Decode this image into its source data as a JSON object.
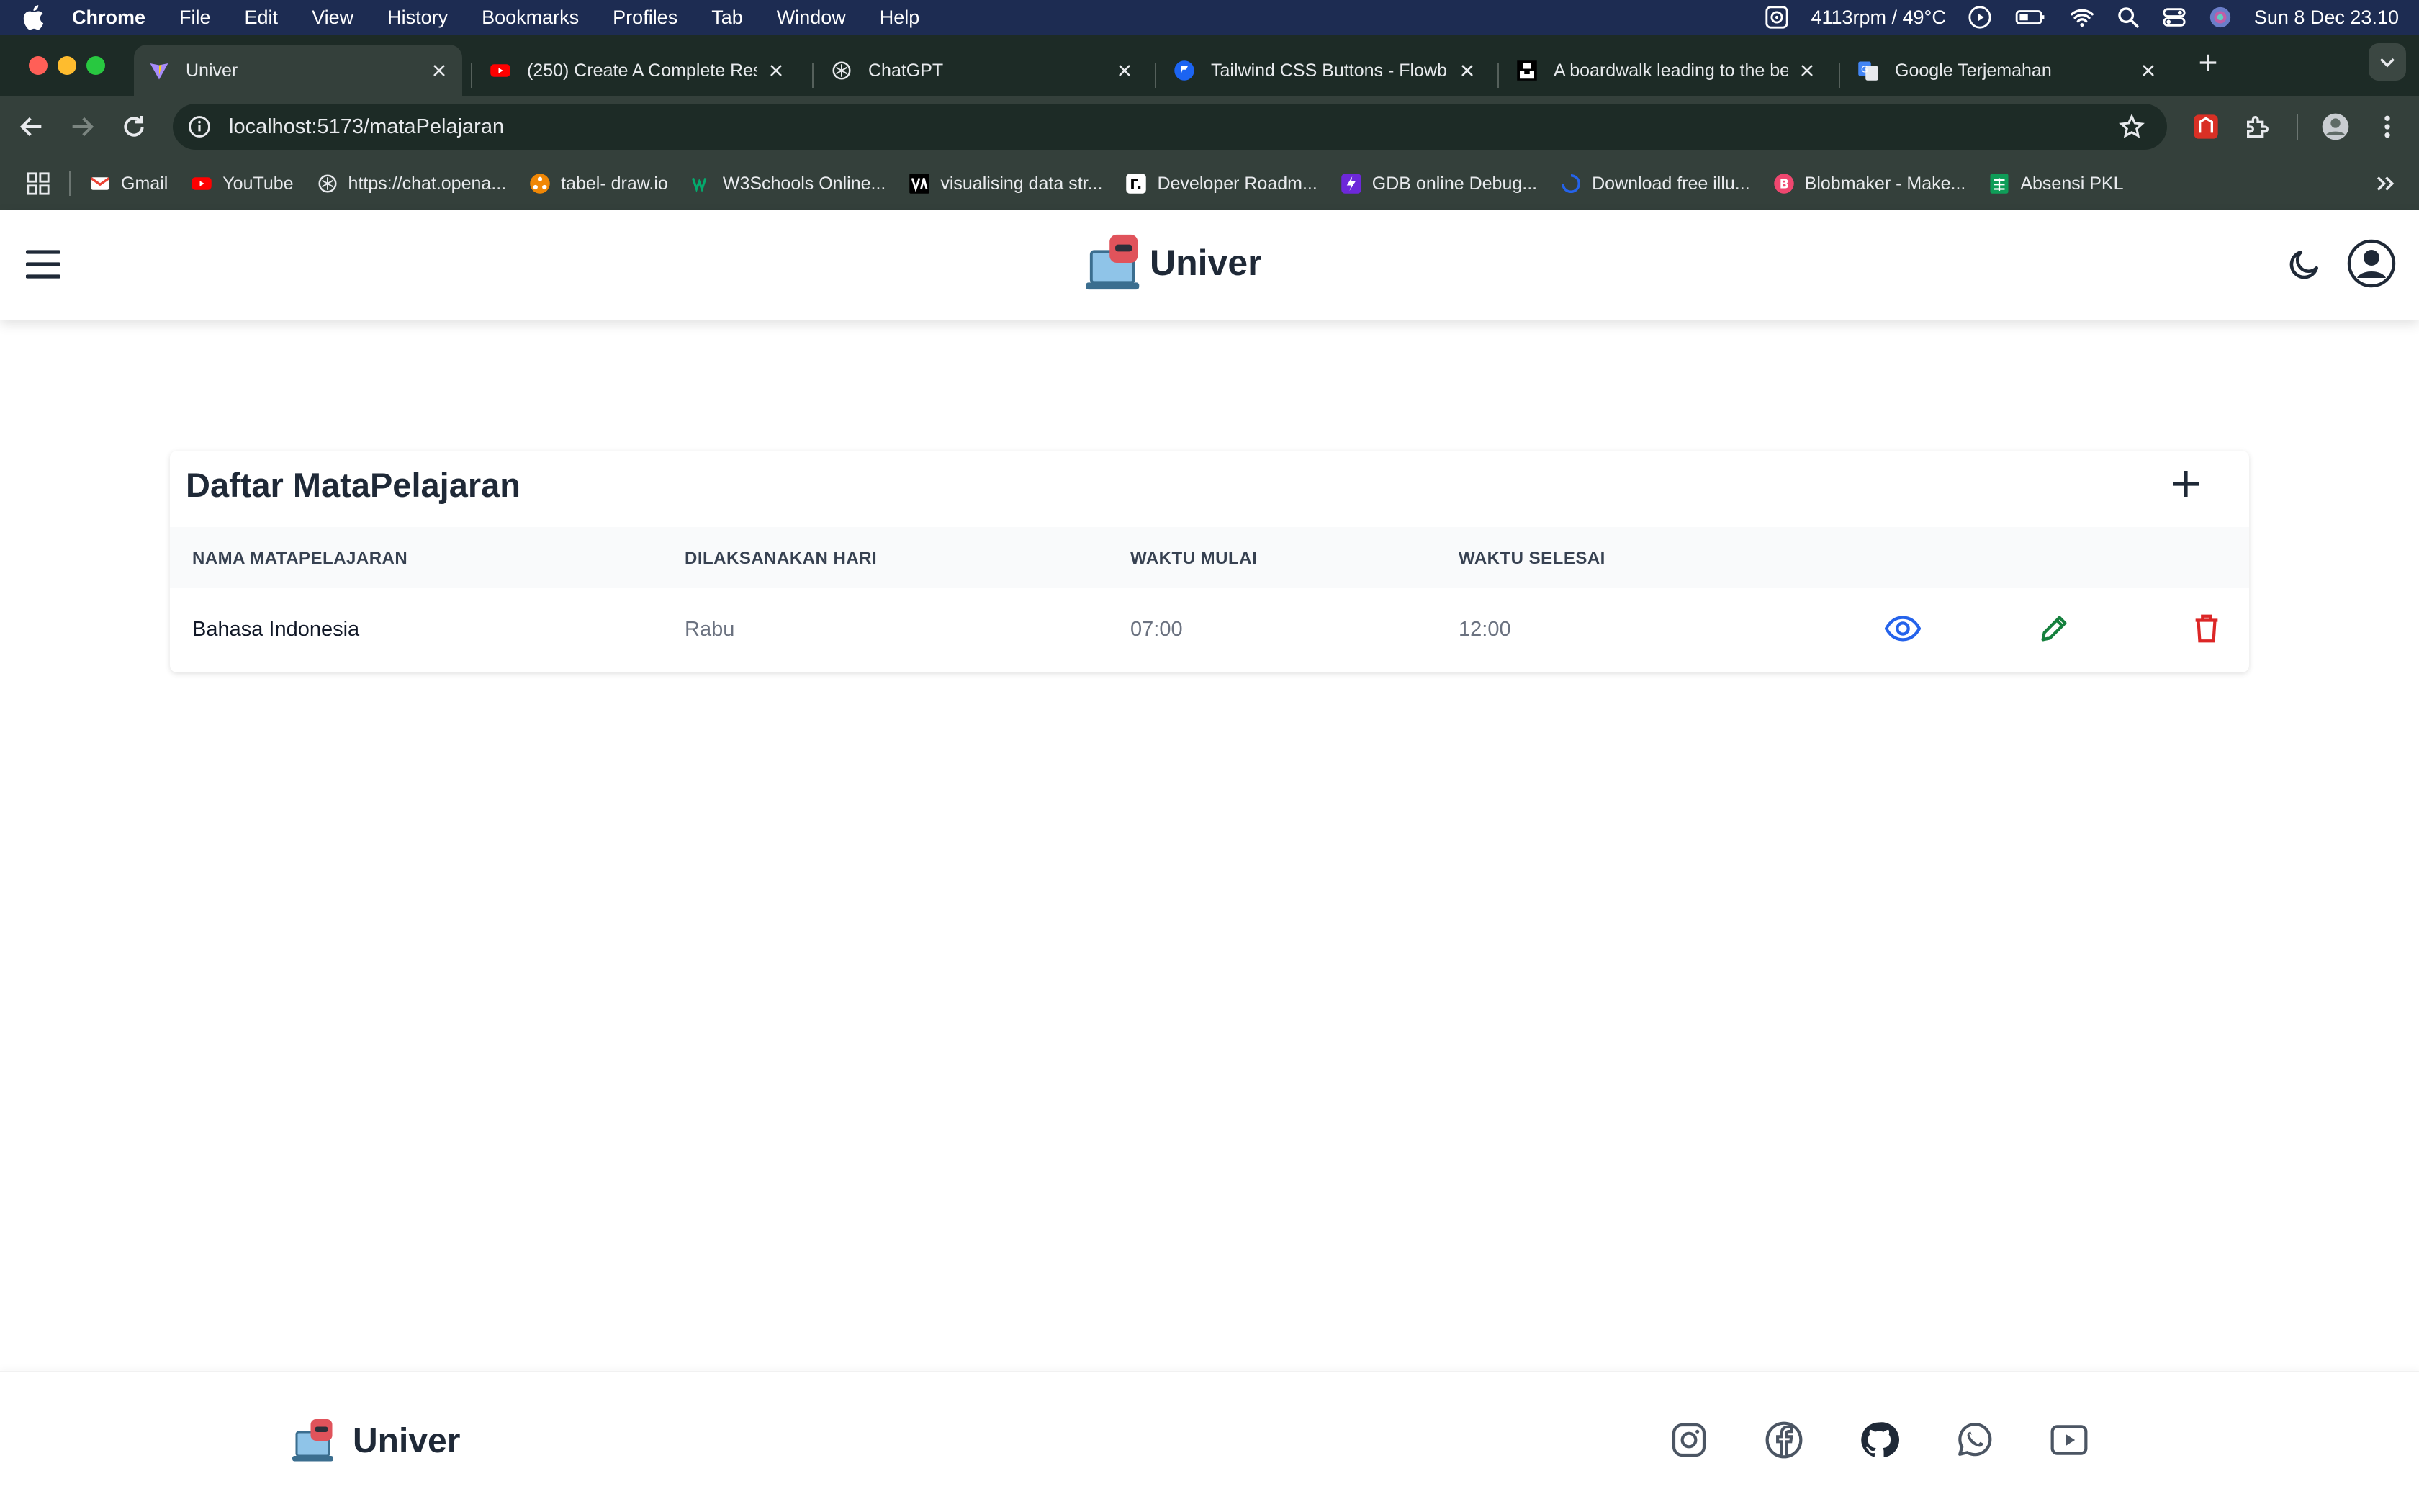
{
  "menubar": {
    "app": "Chrome",
    "items": [
      "File",
      "Edit",
      "View",
      "History",
      "Bookmarks",
      "Profiles",
      "Tab",
      "Window",
      "Help"
    ],
    "fan": "4113rpm / 49°C",
    "datetime": "Sun 8 Dec  23.10"
  },
  "tabs": [
    {
      "title": "Univer",
      "favicon": "vite-icon",
      "active": true
    },
    {
      "title": "(250) Create A Complete Res",
      "favicon": "youtube-icon"
    },
    {
      "title": "ChatGPT",
      "favicon": "chatgpt-icon"
    },
    {
      "title": "Tailwind CSS Buttons - Flowb",
      "favicon": "flowbite-icon"
    },
    {
      "title": "A boardwalk leading to the be",
      "favicon": "unsplash-icon"
    },
    {
      "title": "Google Terjemahan",
      "favicon": "google-translate-icon"
    }
  ],
  "address": {
    "url": "localhost:5173/mataPelajaran"
  },
  "bookmarks": [
    {
      "label": "Gmail",
      "color": "#ea4335"
    },
    {
      "label": "YouTube",
      "color": "#ff0000"
    },
    {
      "label": "https://chat.opena...",
      "color": "#1d2b26"
    },
    {
      "label": "tabel- draw.io",
      "color": "#f08705"
    },
    {
      "label": "W3Schools Online...",
      "color": "#04aa6d"
    },
    {
      "label": "visualising data str...",
      "color": "#000000"
    },
    {
      "label": "Developer Roadm...",
      "color": "#000000"
    },
    {
      "label": "GDB online Debug...",
      "color": "#6d28d9"
    },
    {
      "label": "Download free illu...",
      "color": "#2563eb"
    },
    {
      "label": "Blobmaker - Make...",
      "color": "#ef476f"
    },
    {
      "label": "Absensi PKL",
      "color": "#0f9d58"
    }
  ],
  "header": {
    "brand": "Univer"
  },
  "card": {
    "title": "Daftar MataPelajaran",
    "columns": [
      "NAMA MATAPELAJARAN",
      "DILAKSANAKAN HARI",
      "WAKTU MULAI",
      "WAKTU SELESAI"
    ],
    "rows": [
      {
        "nama": "Bahasa Indonesia",
        "hari": "Rabu",
        "mulai": "07:00",
        "selesai": "12:00"
      }
    ]
  },
  "footer": {
    "brand": "Univer",
    "social": [
      "instagram-icon",
      "facebook-icon",
      "github-icon",
      "whatsapp-icon",
      "youtube-icon"
    ]
  },
  "colors": {
    "view": "#2563eb",
    "edit": "#15803d",
    "delete": "#dc2626",
    "menubar": "#1d2c52",
    "tabstrip": "#1d2b26",
    "toolbar": "#34403b"
  }
}
